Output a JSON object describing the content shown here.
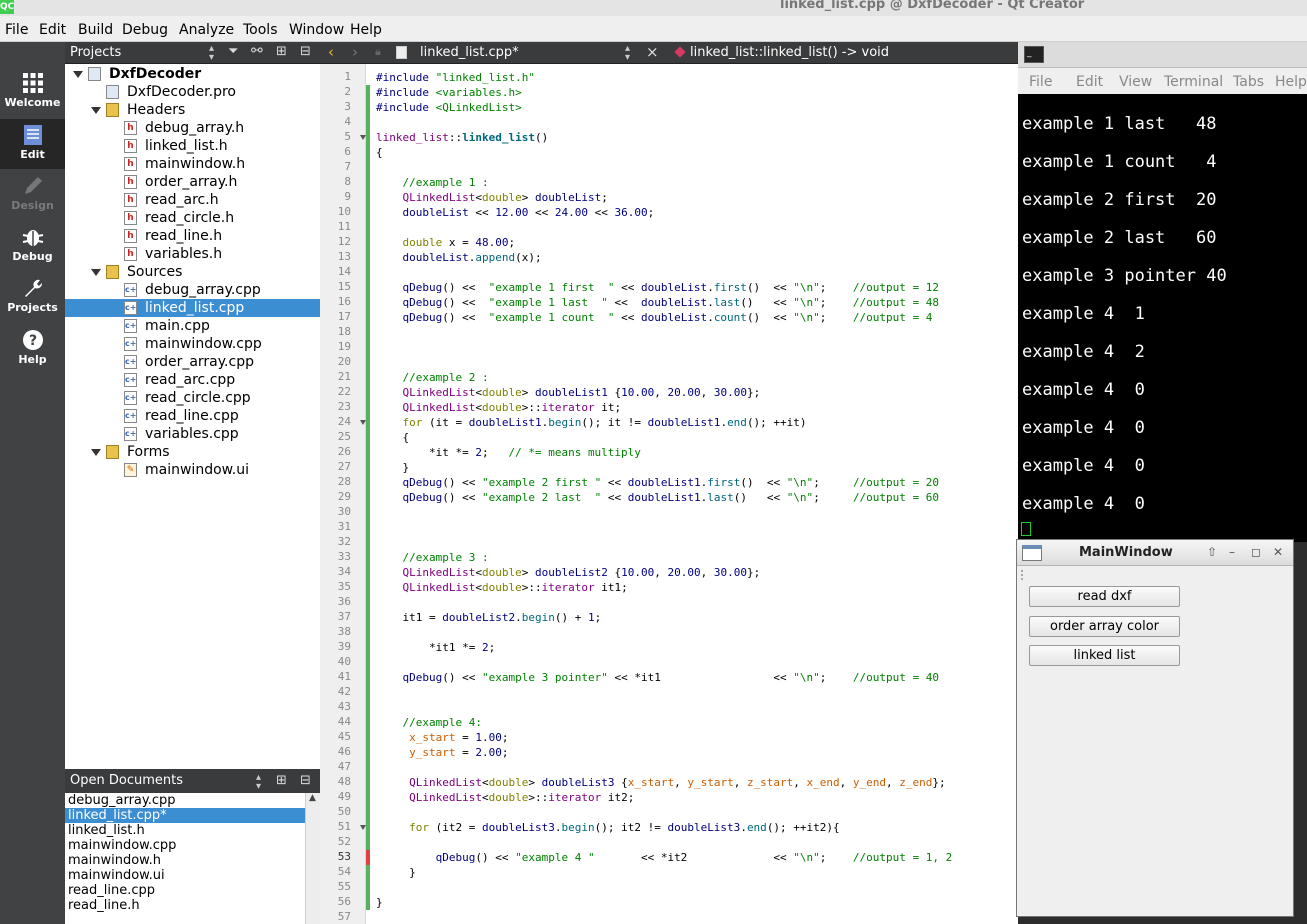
{
  "window": {
    "logo": "QC",
    "title": "linked_list.cpp @ DxfDecoder - Qt Creator"
  },
  "menu": [
    "File",
    "Edit",
    "Build",
    "Debug",
    "Analyze",
    "Tools",
    "Window",
    "Help"
  ],
  "modes": [
    {
      "label": "Welcome",
      "icon": "grid-icon",
      "state": "normal"
    },
    {
      "label": "Edit",
      "icon": "edit-icon",
      "state": "active"
    },
    {
      "label": "Design",
      "icon": "pencil-icon",
      "state": "disabled"
    },
    {
      "label": "Debug",
      "icon": "bug-icon",
      "state": "normal"
    },
    {
      "label": "Projects",
      "icon": "wrench-icon",
      "state": "normal"
    },
    {
      "label": "Help",
      "icon": "help-icon",
      "state": "normal"
    }
  ],
  "projects": {
    "header": "Projects",
    "tree": [
      {
        "label": "DxfDecoder",
        "level": 0,
        "icon": "project",
        "expanded": true,
        "bold": true
      },
      {
        "label": "DxfDecoder.pro",
        "level": 1,
        "icon": "pro"
      },
      {
        "label": "Headers",
        "level": 1,
        "icon": "folder",
        "expanded": true
      },
      {
        "label": "debug_array.h",
        "level": 2,
        "icon": "h"
      },
      {
        "label": "linked_list.h",
        "level": 2,
        "icon": "h"
      },
      {
        "label": "mainwindow.h",
        "level": 2,
        "icon": "h"
      },
      {
        "label": "order_array.h",
        "level": 2,
        "icon": "h"
      },
      {
        "label": "read_arc.h",
        "level": 2,
        "icon": "h"
      },
      {
        "label": "read_circle.h",
        "level": 2,
        "icon": "h"
      },
      {
        "label": "read_line.h",
        "level": 2,
        "icon": "h"
      },
      {
        "label": "variables.h",
        "level": 2,
        "icon": "h"
      },
      {
        "label": "Sources",
        "level": 1,
        "icon": "folder",
        "expanded": true
      },
      {
        "label": "debug_array.cpp",
        "level": 2,
        "icon": "cpp"
      },
      {
        "label": "linked_list.cpp",
        "level": 2,
        "icon": "cpp",
        "selected": true
      },
      {
        "label": "main.cpp",
        "level": 2,
        "icon": "cpp"
      },
      {
        "label": "mainwindow.cpp",
        "level": 2,
        "icon": "cpp"
      },
      {
        "label": "order_array.cpp",
        "level": 2,
        "icon": "cpp"
      },
      {
        "label": "read_arc.cpp",
        "level": 2,
        "icon": "cpp"
      },
      {
        "label": "read_circle.cpp",
        "level": 2,
        "icon": "cpp"
      },
      {
        "label": "read_line.cpp",
        "level": 2,
        "icon": "cpp"
      },
      {
        "label": "variables.cpp",
        "level": 2,
        "icon": "cpp"
      },
      {
        "label": "Forms",
        "level": 1,
        "icon": "folder",
        "expanded": true
      },
      {
        "label": "mainwindow.ui",
        "level": 2,
        "icon": "ui"
      }
    ]
  },
  "open_documents": {
    "header": "Open Documents",
    "items": [
      {
        "label": "debug_array.cpp"
      },
      {
        "label": "linked_list.cpp*",
        "selected": true
      },
      {
        "label": "linked_list.h"
      },
      {
        "label": "mainwindow.cpp"
      },
      {
        "label": "mainwindow.h"
      },
      {
        "label": "mainwindow.ui"
      },
      {
        "label": "read_line.cpp"
      },
      {
        "label": "read_line.h"
      }
    ]
  },
  "editor": {
    "file_tab": "linked_list.cpp*",
    "symbol": "linked_list::linked_list() -> void",
    "current_line": 53,
    "fold_lines": [
      5,
      24,
      51
    ],
    "lines": [
      [
        [
          "pp",
          "#include "
        ],
        [
          "s",
          "\"linked_list.h\""
        ]
      ],
      [
        [
          "pp",
          "#include "
        ],
        [
          "s",
          "<variables.h>"
        ]
      ],
      [
        [
          "pp",
          "#include "
        ],
        [
          "s",
          "<QLinkedList>"
        ]
      ],
      [],
      [
        [
          "t",
          "linked_list"
        ],
        [
          "",
          "::"
        ],
        [
          "fb",
          "linked_list"
        ],
        [
          "",
          "()"
        ]
      ],
      [
        [
          "",
          "{"
        ]
      ],
      [],
      [
        [
          "",
          "    "
        ],
        [
          "c",
          "//example 1 :"
        ]
      ],
      [
        [
          "",
          "    "
        ],
        [
          "t",
          "QLinkedList"
        ],
        [
          "",
          "<"
        ],
        [
          "k",
          "double"
        ],
        [
          "",
          "> "
        ],
        [
          "n",
          "doubleList"
        ],
        [
          "",
          ";"
        ]
      ],
      [
        [
          "",
          "    "
        ],
        [
          "n",
          "doubleList"
        ],
        [
          "",
          " << "
        ],
        [
          "n",
          "12.00"
        ],
        [
          "",
          " << "
        ],
        [
          "n",
          "24.00"
        ],
        [
          "",
          " << "
        ],
        [
          "n",
          "36.00"
        ],
        [
          "",
          ";"
        ]
      ],
      [],
      [
        [
          "",
          "    "
        ],
        [
          "k",
          "double"
        ],
        [
          "",
          " x = "
        ],
        [
          "n",
          "48.00"
        ],
        [
          "",
          ";"
        ]
      ],
      [
        [
          "",
          "    "
        ],
        [
          "n",
          "doubleList"
        ],
        [
          "",
          "."
        ],
        [
          "f",
          "append"
        ],
        [
          "",
          "(x);"
        ]
      ],
      [],
      [
        [
          "",
          "    "
        ],
        [
          "n",
          "qDebug"
        ],
        [
          "",
          "() <<  "
        ],
        [
          "s",
          "\"example 1 first  \""
        ],
        [
          "",
          " << "
        ],
        [
          "n",
          "doubleList"
        ],
        [
          "",
          "."
        ],
        [
          "f",
          "first"
        ],
        [
          "",
          "()  << "
        ],
        [
          "s",
          "\"\\n\""
        ],
        [
          "",
          ";    "
        ],
        [
          "c",
          "//output = 12"
        ]
      ],
      [
        [
          "",
          "    "
        ],
        [
          "n",
          "qDebug"
        ],
        [
          "",
          "() <<  "
        ],
        [
          "s",
          "\"example 1 last  \""
        ],
        [
          "",
          " <<  "
        ],
        [
          "n",
          "doubleList"
        ],
        [
          "",
          "."
        ],
        [
          "f",
          "last"
        ],
        [
          "",
          "()   << "
        ],
        [
          "s",
          "\"\\n\""
        ],
        [
          "",
          ";    "
        ],
        [
          "c",
          "//output = 48"
        ]
      ],
      [
        [
          "",
          "    "
        ],
        [
          "n",
          "qDebug"
        ],
        [
          "",
          "() <<  "
        ],
        [
          "s",
          "\"example 1 count  \""
        ],
        [
          "",
          " << "
        ],
        [
          "n",
          "doubleList"
        ],
        [
          "",
          "."
        ],
        [
          "f",
          "count"
        ],
        [
          "",
          "()  << "
        ],
        [
          "s",
          "\"\\n\""
        ],
        [
          "",
          ";    "
        ],
        [
          "c",
          "//output = 4"
        ]
      ],
      [],
      [],
      [],
      [
        [
          "",
          "    "
        ],
        [
          "c",
          "//example 2 :"
        ]
      ],
      [
        [
          "",
          "    "
        ],
        [
          "t",
          "QLinkedList"
        ],
        [
          "",
          "<"
        ],
        [
          "k",
          "double"
        ],
        [
          "",
          "> "
        ],
        [
          "n",
          "doubleList1"
        ],
        [
          "",
          " {"
        ],
        [
          "n",
          "10.00"
        ],
        [
          "",
          ", "
        ],
        [
          "n",
          "20.00"
        ],
        [
          "",
          ", "
        ],
        [
          "n",
          "30.00"
        ],
        [
          "",
          "};"
        ]
      ],
      [
        [
          "",
          "    "
        ],
        [
          "t",
          "QLinkedList"
        ],
        [
          "",
          "<"
        ],
        [
          "k",
          "double"
        ],
        [
          "",
          ">::"
        ],
        [
          "t",
          "iterator"
        ],
        [
          "",
          " it;"
        ]
      ],
      [
        [
          "",
          "    "
        ],
        [
          "k",
          "for"
        ],
        [
          "",
          " (it = "
        ],
        [
          "n",
          "doubleList1"
        ],
        [
          "",
          "."
        ],
        [
          "f",
          "begin"
        ],
        [
          "",
          "(); it != "
        ],
        [
          "n",
          "doubleList1"
        ],
        [
          "",
          "."
        ],
        [
          "f",
          "end"
        ],
        [
          "",
          "(); ++it)"
        ]
      ],
      [
        [
          "",
          "    {"
        ]
      ],
      [
        [
          "",
          "        *it *= "
        ],
        [
          "n",
          "2"
        ],
        [
          "",
          ";   "
        ],
        [
          "c",
          "// *= means multiply"
        ]
      ],
      [
        [
          "",
          "    }"
        ]
      ],
      [
        [
          "",
          "    "
        ],
        [
          "n",
          "qDebug"
        ],
        [
          "",
          "() << "
        ],
        [
          "s",
          "\"example 2 first \""
        ],
        [
          "",
          " << "
        ],
        [
          "n",
          "doubleList1"
        ],
        [
          "",
          "."
        ],
        [
          "f",
          "first"
        ],
        [
          "",
          "()  << "
        ],
        [
          "s",
          "\"\\n\""
        ],
        [
          "",
          ";     "
        ],
        [
          "c",
          "//output = 20"
        ]
      ],
      [
        [
          "",
          "    "
        ],
        [
          "n",
          "qDebug"
        ],
        [
          "",
          "() << "
        ],
        [
          "s",
          "\"example 2 last  \""
        ],
        [
          "",
          " << "
        ],
        [
          "n",
          "doubleList1"
        ],
        [
          "",
          "."
        ],
        [
          "f",
          "last"
        ],
        [
          "",
          "()   << "
        ],
        [
          "s",
          "\"\\n\""
        ],
        [
          "",
          ";     "
        ],
        [
          "c",
          "//output = 60"
        ]
      ],
      [],
      [],
      [],
      [
        [
          "",
          "    "
        ],
        [
          "c",
          "//example 3 :"
        ]
      ],
      [
        [
          "",
          "    "
        ],
        [
          "t",
          "QLinkedList"
        ],
        [
          "",
          "<"
        ],
        [
          "k",
          "double"
        ],
        [
          "",
          "> "
        ],
        [
          "n",
          "doubleList2"
        ],
        [
          "",
          " {"
        ],
        [
          "n",
          "10.00"
        ],
        [
          "",
          ", "
        ],
        [
          "n",
          "20.00"
        ],
        [
          "",
          ", "
        ],
        [
          "n",
          "30.00"
        ],
        [
          "",
          "};"
        ]
      ],
      [
        [
          "",
          "    "
        ],
        [
          "t",
          "QLinkedList"
        ],
        [
          "",
          "<"
        ],
        [
          "k",
          "double"
        ],
        [
          "",
          ">::"
        ],
        [
          "t",
          "iterator"
        ],
        [
          "",
          " it1;"
        ]
      ],
      [],
      [
        [
          "",
          "    it1 = "
        ],
        [
          "n",
          "doubleList2"
        ],
        [
          "",
          "."
        ],
        [
          "f",
          "begin"
        ],
        [
          "",
          "() + "
        ],
        [
          "n",
          "1"
        ],
        [
          "",
          ";"
        ]
      ],
      [],
      [
        [
          "",
          "        *it1 *= "
        ],
        [
          "n",
          "2"
        ],
        [
          "",
          ";"
        ]
      ],
      [],
      [
        [
          "",
          "    "
        ],
        [
          "n",
          "qDebug"
        ],
        [
          "",
          "() << "
        ],
        [
          "s",
          "\"example 3 pointer\""
        ],
        [
          "",
          " << *it1                 << "
        ],
        [
          "s",
          "\"\\n\""
        ],
        [
          "",
          ";    "
        ],
        [
          "c",
          "//output = 40"
        ]
      ],
      [],
      [],
      [
        [
          "",
          "    "
        ],
        [
          "c",
          "//example 4:"
        ]
      ],
      [
        [
          "",
          "     "
        ],
        [
          "o",
          "x_start"
        ],
        [
          "",
          " = "
        ],
        [
          "n",
          "1.00"
        ],
        [
          "",
          ";"
        ]
      ],
      [
        [
          "",
          "     "
        ],
        [
          "o",
          "y_start"
        ],
        [
          "",
          " = "
        ],
        [
          "n",
          "2.00"
        ],
        [
          "",
          ";"
        ]
      ],
      [],
      [
        [
          "",
          "     "
        ],
        [
          "t",
          "QLinkedList"
        ],
        [
          "",
          "<"
        ],
        [
          "k",
          "double"
        ],
        [
          "",
          "> "
        ],
        [
          "n",
          "doubleList3"
        ],
        [
          "",
          " {"
        ],
        [
          "o",
          "x_start"
        ],
        [
          "",
          ", "
        ],
        [
          "o",
          "y_start"
        ],
        [
          "",
          ", "
        ],
        [
          "o",
          "z_start"
        ],
        [
          "",
          ", "
        ],
        [
          "o",
          "x_end"
        ],
        [
          "",
          ", "
        ],
        [
          "o",
          "y_end"
        ],
        [
          "",
          ", "
        ],
        [
          "o",
          "z_end"
        ],
        [
          "",
          "};"
        ]
      ],
      [
        [
          "",
          "     "
        ],
        [
          "t",
          "QLinkedList"
        ],
        [
          "",
          "<"
        ],
        [
          "k",
          "double"
        ],
        [
          "",
          ">::"
        ],
        [
          "t",
          "iterator"
        ],
        [
          "",
          " it2;"
        ]
      ],
      [],
      [
        [
          "",
          "     "
        ],
        [
          "k",
          "for"
        ],
        [
          "",
          " (it2 = "
        ],
        [
          "n",
          "doubleList3"
        ],
        [
          "",
          "."
        ],
        [
          "f",
          "begin"
        ],
        [
          "",
          "(); it2 != "
        ],
        [
          "n",
          "doubleList3"
        ],
        [
          "",
          "."
        ],
        [
          "f",
          "end"
        ],
        [
          "",
          "(); ++it2){"
        ]
      ],
      [],
      [
        [
          "",
          "         "
        ],
        [
          "n",
          "qDebug"
        ],
        [
          "",
          "() << "
        ],
        [
          "s",
          "\"example 4 \""
        ],
        [
          "",
          "       << *it2             << "
        ],
        [
          "s",
          "\"\\n\""
        ],
        [
          "",
          ";    "
        ],
        [
          "c",
          "//output = 1, 2"
        ]
      ],
      [
        [
          "",
          "     }"
        ]
      ],
      [],
      [
        [
          "",
          "}"
        ]
      ],
      []
    ]
  },
  "terminal": {
    "menu": [
      "File",
      "Edit",
      "View",
      "Terminal",
      "Tabs",
      "Help"
    ],
    "lines": [
      "example 1 last   48",
      "example 1 count   4",
      "example 2 first  20",
      "example 2 last   60",
      "example 3 pointer 40",
      "example 4  1",
      "example 4  2",
      "example 4  0",
      "example 4  0",
      "example 4  0",
      "example 4  0"
    ]
  },
  "mainwindow": {
    "title": "MainWindow",
    "buttons": [
      "read dxf",
      "order array color",
      "linked list"
    ]
  }
}
